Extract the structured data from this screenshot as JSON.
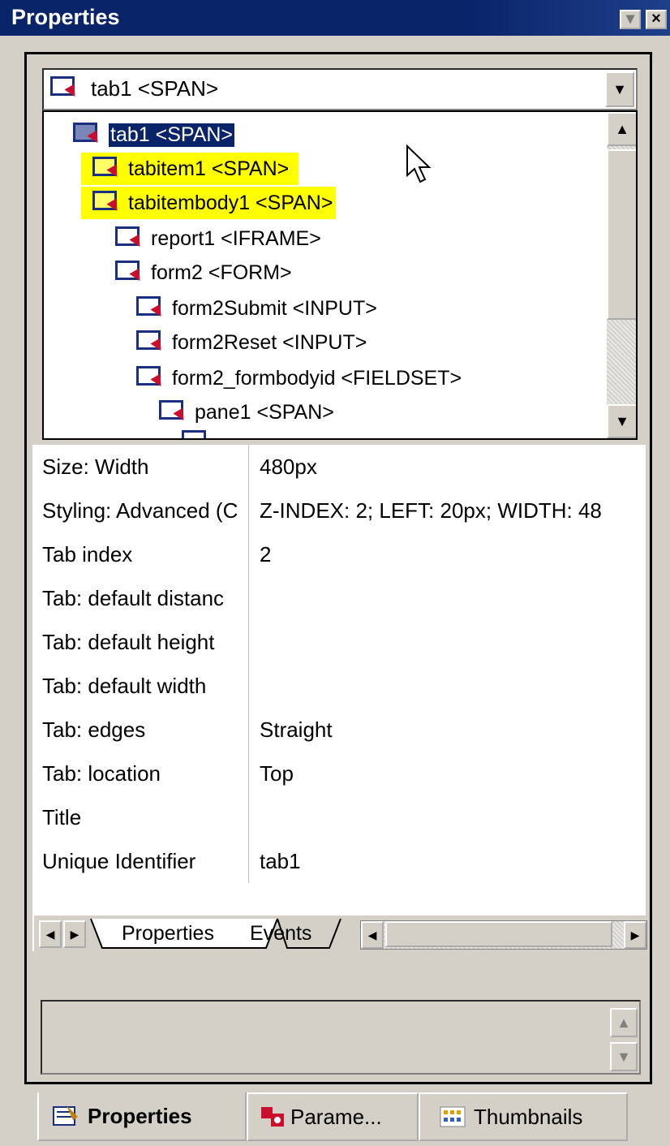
{
  "window": {
    "title": "Properties"
  },
  "combo": {
    "selected": "tab1 <SPAN>"
  },
  "tree": {
    "items": [
      {
        "label": "tab1 <SPAN>",
        "level": 0
      },
      {
        "label": "tabitem1 <SPAN>",
        "level": 1
      },
      {
        "label": "tabitembody1 <SPAN>",
        "level": 1
      },
      {
        "label": "report1 <IFRAME>",
        "level": 2
      },
      {
        "label": "form2 <FORM>",
        "level": 2
      },
      {
        "label": "form2Submit <INPUT>",
        "level": 3
      },
      {
        "label": "form2Reset <INPUT>",
        "level": 3
      },
      {
        "label": "form2_formbodyid <FIELDSET>",
        "level": 3
      },
      {
        "label": "pane1 <SPAN>",
        "level": 4
      }
    ]
  },
  "properties": [
    {
      "name": "Size: Width",
      "value": "480px"
    },
    {
      "name": "Styling: Advanced (C",
      "value": "Z-INDEX: 2; LEFT: 20px; WIDTH: 48"
    },
    {
      "name": "Tab index",
      "value": "2"
    },
    {
      "name": "Tab: default distanc",
      "value": ""
    },
    {
      "name": "Tab: default height",
      "value": ""
    },
    {
      "name": "Tab: default width",
      "value": ""
    },
    {
      "name": "Tab: edges",
      "value": "Straight"
    },
    {
      "name": "Tab: location",
      "value": "Top"
    },
    {
      "name": "Title",
      "value": ""
    },
    {
      "name": "Unique Identifier",
      "value": "tab1"
    }
  ],
  "sheet_tabs": {
    "properties": "Properties",
    "events": "Events"
  },
  "bottom_tabs": {
    "properties": "Properties",
    "parameters": "Parame...",
    "thumbnails": "Thumbnails"
  },
  "colors": {
    "titlebar": "#0a246a",
    "highlight": "#ffff00",
    "selection": "#0a246a"
  }
}
